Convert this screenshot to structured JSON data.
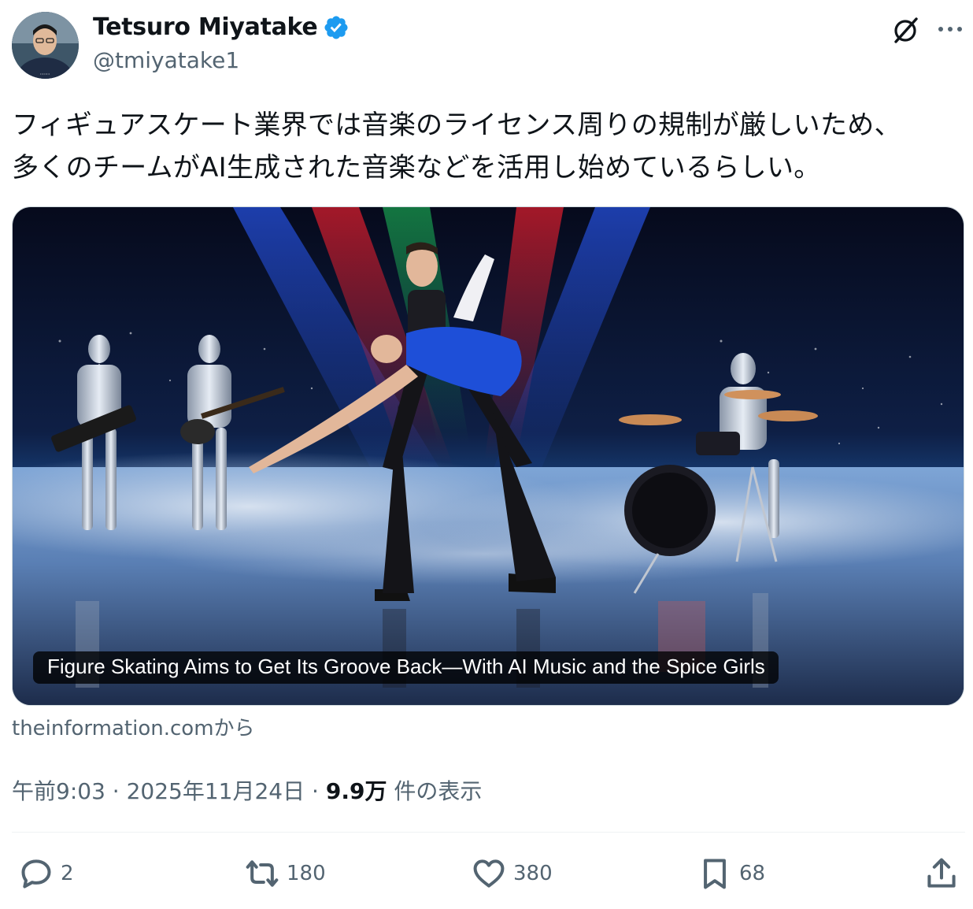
{
  "author": {
    "display_name": "Tetsuro Miyatake",
    "handle": "@tmiyatake1",
    "verified": true,
    "avatar_icon": "profile-photo"
  },
  "tweet": {
    "text_lines": [
      "フィギュアスケート業界では音楽のライセンス周りの規制が厳しいため、",
      "多くのチームがAI生成された音楽などを活用し始めているらしい。"
    ]
  },
  "card": {
    "title": "Figure Skating Aims to Get Its Groove Back—With AI Music and the Spice Girls",
    "source": "theinformation.comから",
    "image_icon": "figure-skaters-with-robot-band-image"
  },
  "meta": {
    "time": "午前9:03",
    "separator": "·",
    "date": "2025年11月24日",
    "views_count": "9.9万",
    "views_label": "件の表示"
  },
  "actions": {
    "reply_count": "2",
    "repost_count": "180",
    "like_count": "380",
    "bookmark_count": "68"
  },
  "colors": {
    "accent": "#1d9bf0",
    "text": "#0f1419",
    "secondary": "#536471"
  }
}
